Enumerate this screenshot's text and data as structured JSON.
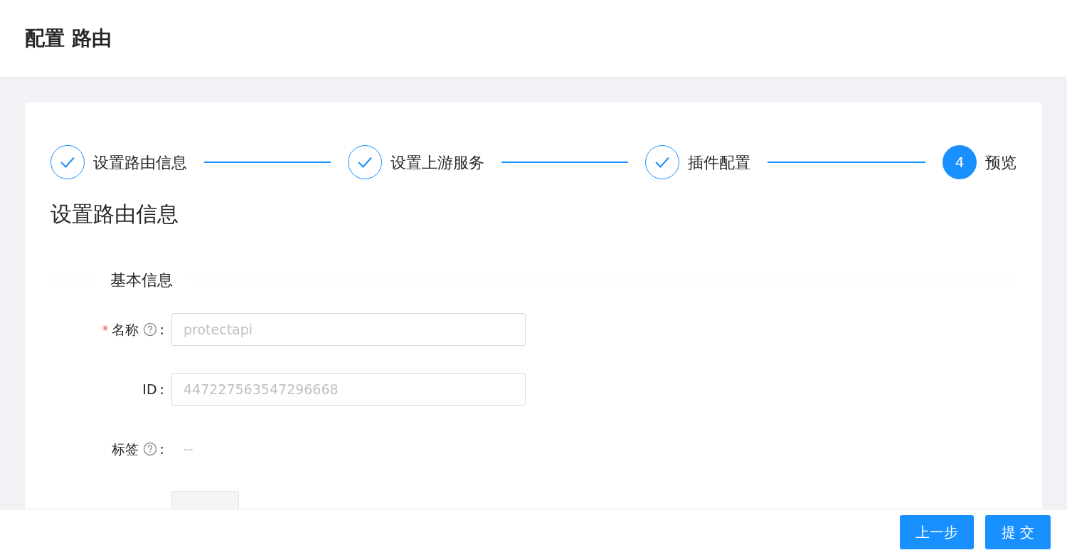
{
  "page_title": "配置 路由",
  "steps": [
    {
      "kind": "done",
      "label": "设置路由信息"
    },
    {
      "kind": "done",
      "label": "设置上游服务"
    },
    {
      "kind": "done",
      "label": "插件配置"
    },
    {
      "kind": "current",
      "number": "4",
      "label": "预览"
    }
  ],
  "section_title": "设置路由信息",
  "divider_title": "基本信息",
  "fields": [
    {
      "kind": "input",
      "required_mark": "*",
      "label": "名称",
      "help": true,
      "colon": ":",
      "value": "protectapi",
      "disabled": true
    },
    {
      "kind": "input",
      "label": "ID",
      "help": false,
      "colon": ":",
      "value": "447227563547296668",
      "disabled": true
    },
    {
      "kind": "text",
      "label": "标签",
      "help": true,
      "colon": ":",
      "value": "--"
    },
    {
      "kind": "dashed-button"
    }
  ],
  "footer_buttons": [
    "上一步",
    "提 交"
  ]
}
